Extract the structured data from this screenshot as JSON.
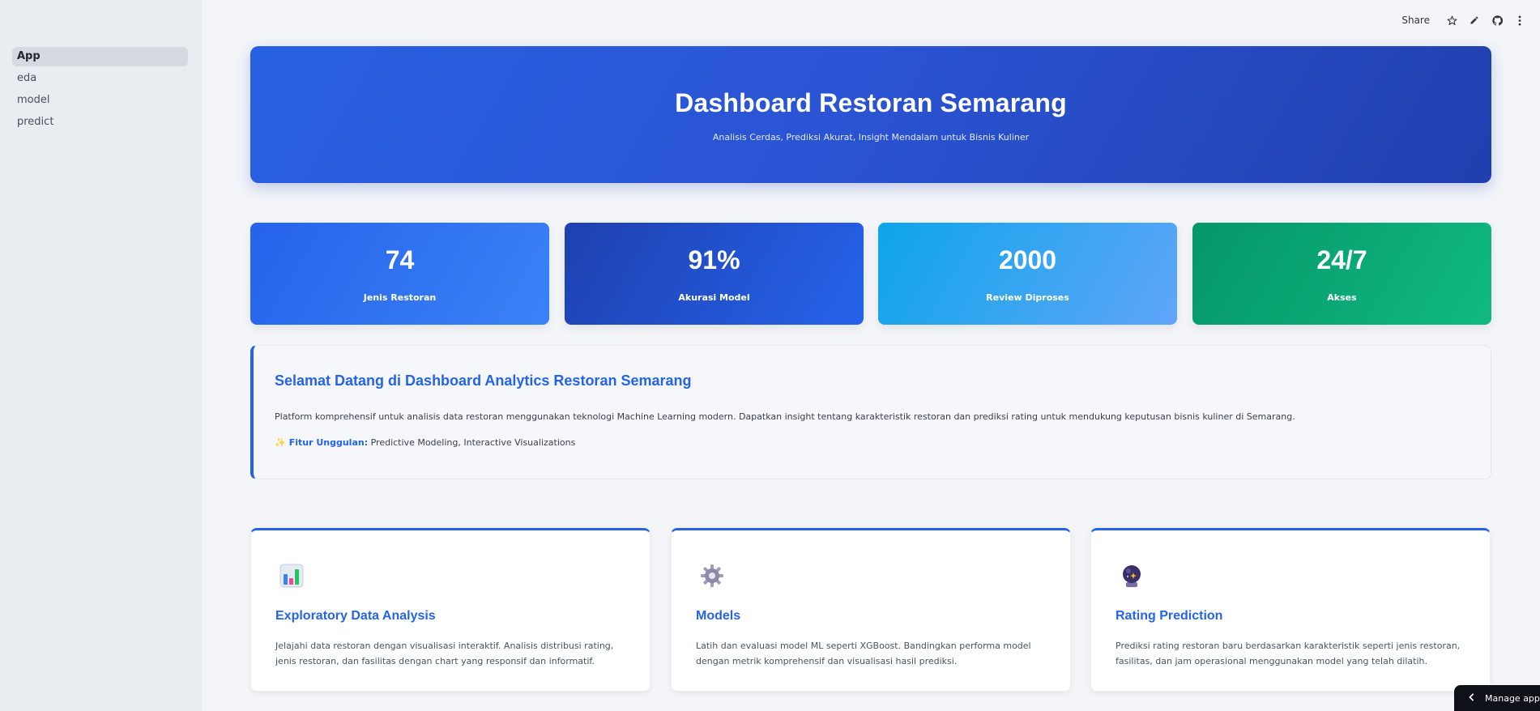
{
  "sidebar": {
    "items": [
      {
        "label": "App"
      },
      {
        "label": "eda"
      },
      {
        "label": "model"
      },
      {
        "label": "predict"
      }
    ]
  },
  "topbar": {
    "share_label": "Share",
    "icons": [
      "star-icon",
      "pencil-icon",
      "github-icon",
      "more-vertical-icon"
    ]
  },
  "hero": {
    "title": "Dashboard Restoran Semarang",
    "subtitle": "Analisis Cerdas, Prediksi Akurat, Insight Mendalam untuk Bisnis Kuliner"
  },
  "stats": [
    {
      "value": "74",
      "label": "Jenis Restoran"
    },
    {
      "value": "91%",
      "label": "Akurasi Model"
    },
    {
      "value": "2000",
      "label": "Review Diproses"
    },
    {
      "value": "24/7",
      "label": "Akses"
    }
  ],
  "welcome": {
    "title": "Selamat Datang di Dashboard Analytics Restoran Semarang",
    "text": "Platform komprehensif untuk analisis data restoran menggunakan teknologi Machine Learning modern. Dapatkan insight tentang karakteristik restoran dan prediksi rating untuk mendukung keputusan bisnis kuliner di Semarang.",
    "feature_label": "Fitur Unggulan:",
    "feature_text": "Predictive Modeling, Interactive Visualizations"
  },
  "cards": [
    {
      "icon": "bar-chart-icon",
      "title": "Exploratory Data Analysis",
      "desc": "Jelajahi data restoran dengan visualisasi interaktif. Analisis distribusi rating, jenis restoran, dan fasilitas dengan chart yang responsif dan informatif."
    },
    {
      "icon": "gear-icon",
      "title": "Models",
      "desc": "Latih dan evaluasi model ML seperti XGBoost. Bandingkan performa model dengan metrik komprehensif dan visualisasi hasil prediksi."
    },
    {
      "icon": "crystal-ball-icon",
      "title": "Rating Prediction",
      "desc": "Prediksi rating restoran baru berdasarkan karakteristik seperti jenis restoran, fasilitas, dan jam operasional menggunakan model yang telah dilatih."
    }
  ],
  "manage_app": {
    "label": "Manage app"
  },
  "colors": {
    "accent": "#2563eb",
    "sidebar_bg": "#e9ecf0",
    "page_bg": "#f3f5f9"
  }
}
